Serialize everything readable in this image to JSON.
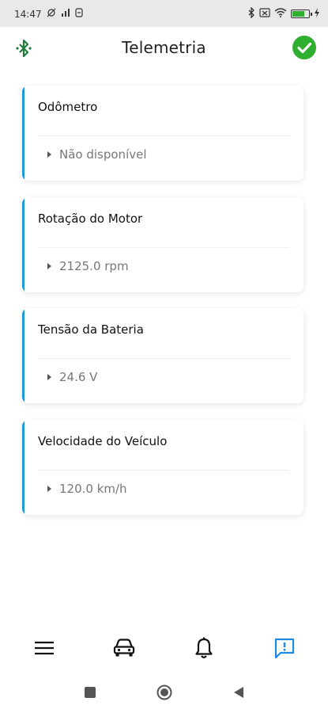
{
  "status_bar": {
    "time": "14:47",
    "left_icons": [
      "alarm-off-icon",
      "signal-icon",
      "app-icon"
    ],
    "right_icons": [
      "bluetooth-icon",
      "sim-icon",
      "wifi-icon",
      "battery-icon",
      "charging-icon"
    ]
  },
  "header": {
    "title": "Telemetria",
    "left_icon": "bluetooth-icon",
    "right_icon": "check-circle-icon",
    "check_color": "#2fae2f",
    "bluetooth_color": "#1f7a3a"
  },
  "cards": [
    {
      "title": "Odômetro",
      "value": "Não disponível"
    },
    {
      "title": "Rotação do Motor",
      "value": "2125.0 rpm"
    },
    {
      "title": "Tensão da Bateria",
      "value": "24.6 V"
    },
    {
      "title": "Velocidade do Veículo",
      "value": "120.0 km/h"
    }
  ],
  "accent_color": "#1e9bd7",
  "bottom_nav": {
    "items": [
      {
        "icon": "menu-icon",
        "active": false
      },
      {
        "icon": "car-icon",
        "active": false
      },
      {
        "icon": "bell-icon",
        "active": false
      },
      {
        "icon": "alert-message-icon",
        "active": true
      }
    ],
    "active_color": "#1e88e5"
  },
  "system_nav": [
    "recent-apps-icon",
    "home-icon",
    "back-icon"
  ]
}
